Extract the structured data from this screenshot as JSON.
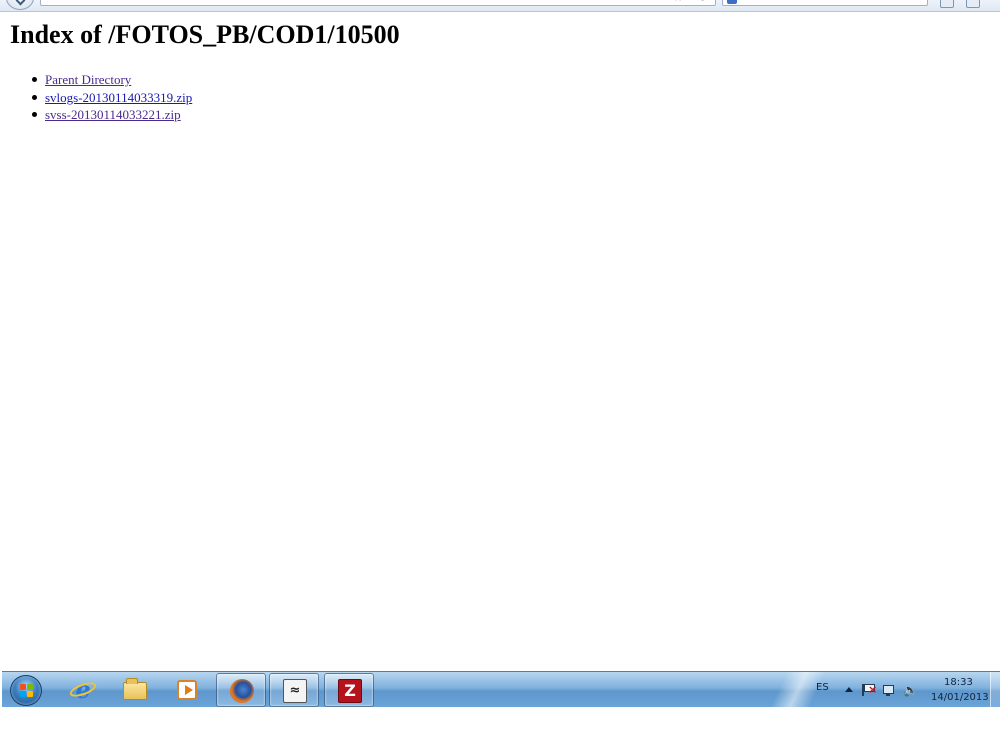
{
  "page": {
    "title": "Index of /FOTOS_PB/COD1/10500",
    "entries": [
      {
        "label": "Parent Directory",
        "visited": true
      },
      {
        "label": "svlogs-20130114033319.zip",
        "visited": false
      },
      {
        "label": "svss-20130114033221.zip",
        "visited": true
      }
    ]
  },
  "taskbar": {
    "apps": [
      {
        "name": "internet-explorer-icon",
        "active": false
      },
      {
        "name": "file-explorer-icon",
        "active": false
      },
      {
        "name": "media-player-icon",
        "active": false
      },
      {
        "name": "firefox-icon",
        "active": true
      },
      {
        "name": "remote-desktop-icon",
        "active": true
      },
      {
        "name": "filezilla-icon",
        "active": true
      }
    ],
    "tray": {
      "language": "ES",
      "time": "18:33",
      "date": "14/01/2013"
    }
  },
  "colors": {
    "link_visited": "#4a2a8c",
    "link_unvisited": "#1a1ab0",
    "taskbar": "#6aa4d8"
  }
}
